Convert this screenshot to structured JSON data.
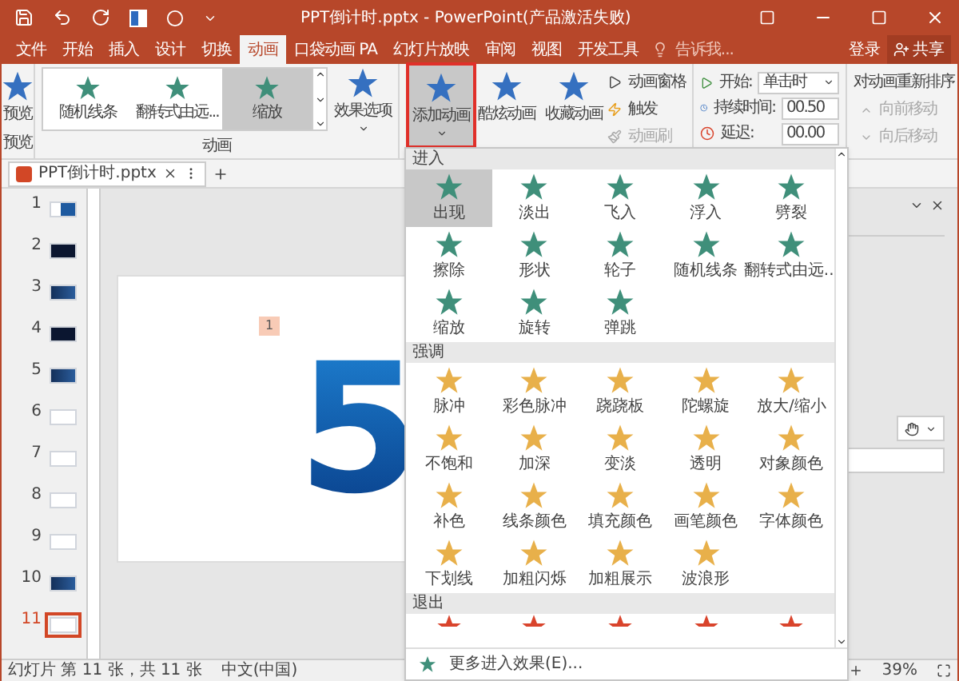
{
  "title_bar": {
    "title": "PPT倒计时.pptx - PowerPoint(产品激活失败)"
  },
  "menu_tabs": [
    {
      "label": "文件",
      "selected": false
    },
    {
      "label": "开始",
      "selected": false
    },
    {
      "label": "插入",
      "selected": false
    },
    {
      "label": "设计",
      "selected": false
    },
    {
      "label": "切换",
      "selected": false
    },
    {
      "label": "动画",
      "selected": true
    },
    {
      "label": "口袋动画 PA",
      "selected": false
    },
    {
      "label": "幻灯片放映",
      "selected": false
    },
    {
      "label": "审阅",
      "selected": false
    },
    {
      "label": "视图",
      "selected": false
    },
    {
      "label": "开发工具",
      "selected": false
    }
  ],
  "tell_me": {
    "placeholder": "告诉我..."
  },
  "sign_in": "登录",
  "share": "共享",
  "ribbon": {
    "preview": {
      "label": "预览",
      "group": "预览"
    },
    "gallery": {
      "group": "动画",
      "items": [
        {
          "label": "随机线条",
          "selected": false
        },
        {
          "label": "翻转式由远...",
          "selected": false
        },
        {
          "label": "缩放",
          "selected": true
        }
      ]
    },
    "effect_options": "效果选项",
    "add_animation": {
      "label": "添加动画",
      "expanded": true
    },
    "big_buttons": [
      {
        "label": "酷炫动画"
      },
      {
        "label": "收藏动画"
      }
    ],
    "small_buttons": [
      {
        "label": "动画窗格",
        "disabled": false,
        "kind": "pane"
      },
      {
        "label": "触发",
        "disabled": false,
        "kind": "trigger"
      },
      {
        "label": "动画刷",
        "disabled": true,
        "kind": "brush"
      }
    ],
    "timing": {
      "start_label": "开始:",
      "start_value": "单击时",
      "duration_label": "持续时间:",
      "duration_value": "00.50",
      "delay_label": "延迟:",
      "delay_value": "00.00",
      "reorder_title": "对动画重新排序",
      "moves": [
        {
          "label": "向前移动",
          "disabled": true,
          "kind": "up"
        },
        {
          "label": "向后移动",
          "disabled": true,
          "kind": "down"
        }
      ]
    }
  },
  "document_tab": {
    "title": "PPT倒计时.pptx"
  },
  "slides": [
    {
      "number": "1",
      "selected": false,
      "kind": "mixed"
    },
    {
      "number": "2",
      "selected": false,
      "kind": "dark"
    },
    {
      "number": "3",
      "selected": false,
      "kind": "blue"
    },
    {
      "number": "4",
      "selected": false,
      "kind": "dark"
    },
    {
      "number": "5",
      "selected": false,
      "kind": "blue"
    },
    {
      "number": "6",
      "selected": false,
      "kind": "light"
    },
    {
      "number": "7",
      "selected": false,
      "kind": "light"
    },
    {
      "number": "8",
      "selected": false,
      "kind": "light"
    },
    {
      "number": "9",
      "selected": false,
      "kind": "light"
    },
    {
      "number": "10",
      "selected": false,
      "kind": "blue"
    },
    {
      "number": "11",
      "selected": true,
      "kind": "light"
    }
  ],
  "slide": {
    "tag": "1",
    "big_number": "5"
  },
  "animation_menu": {
    "sections": [
      {
        "title": "进入",
        "kind": "entrance",
        "items": [
          {
            "label": "出现",
            "selected": true
          },
          {
            "label": "淡出",
            "selected": false
          },
          {
            "label": "飞入",
            "selected": false
          },
          {
            "label": "浮入",
            "selected": false
          },
          {
            "label": "劈裂",
            "selected": false
          },
          {
            "label": "擦除",
            "selected": false
          },
          {
            "label": "形状",
            "selected": false
          },
          {
            "label": "轮子",
            "selected": false
          },
          {
            "label": "随机线条",
            "selected": false
          },
          {
            "label": "翻转式由远...",
            "selected": false
          },
          {
            "label": "缩放",
            "selected": false
          },
          {
            "label": "旋转",
            "selected": false
          },
          {
            "label": "弹跳",
            "selected": false
          }
        ]
      },
      {
        "title": "强调",
        "kind": "emphasis",
        "items": [
          {
            "label": "脉冲",
            "selected": false
          },
          {
            "label": "彩色脉冲",
            "selected": false
          },
          {
            "label": "跷跷板",
            "selected": false
          },
          {
            "label": "陀螺旋",
            "selected": false
          },
          {
            "label": "放大/缩小",
            "selected": false
          },
          {
            "label": "不饱和",
            "selected": false
          },
          {
            "label": "加深",
            "selected": false
          },
          {
            "label": "变淡",
            "selected": false
          },
          {
            "label": "透明",
            "selected": false
          },
          {
            "label": "对象颜色",
            "selected": false
          },
          {
            "label": "补色",
            "selected": false
          },
          {
            "label": "线条颜色",
            "selected": false
          },
          {
            "label": "填充颜色",
            "selected": false
          },
          {
            "label": "画笔颜色",
            "selected": false
          },
          {
            "label": "字体颜色",
            "selected": false
          },
          {
            "label": "下划线",
            "selected": false
          },
          {
            "label": "加粗闪烁",
            "selected": false
          },
          {
            "label": "加粗展示",
            "selected": false
          },
          {
            "label": "波浪形",
            "selected": false
          }
        ]
      },
      {
        "title": "退出",
        "kind": "exit"
      }
    ],
    "footer": [
      {
        "label": "更多进入效果(E)...",
        "kind": "entrance"
      }
    ]
  },
  "status_bar": {
    "slide_info": "幻灯片 第 11 张，共 11 张",
    "language": "中文(中国)",
    "zoom": "39%"
  }
}
